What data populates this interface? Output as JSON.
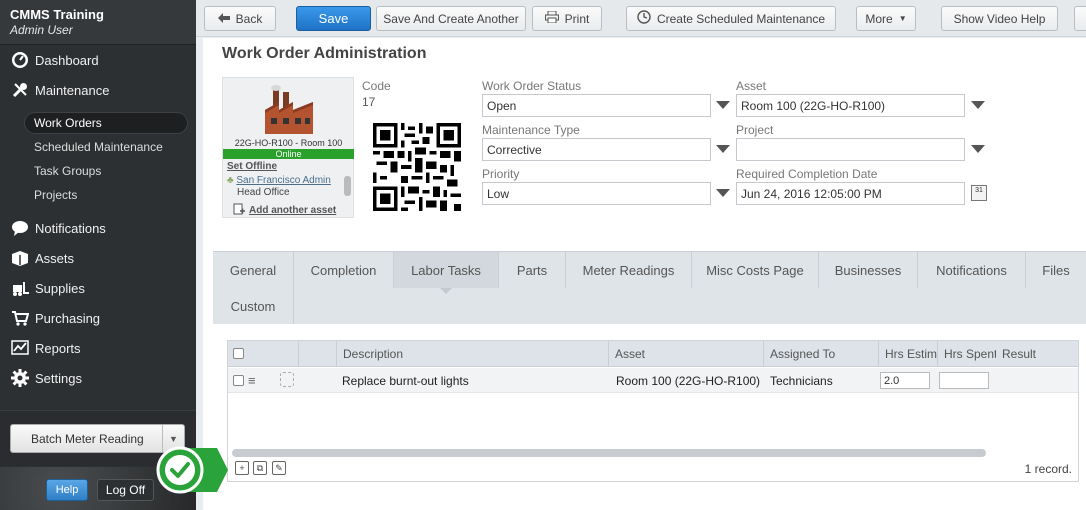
{
  "app": {
    "name": "CMMS Training",
    "user": "Admin User"
  },
  "sidebar": {
    "items": [
      {
        "label": "Dashboard",
        "icon": "dashboard-icon"
      },
      {
        "label": "Maintenance",
        "icon": "tools-icon"
      },
      {
        "label": "Notifications",
        "icon": "chat-bubble-icon"
      },
      {
        "label": "Assets",
        "icon": "boxes-icon"
      },
      {
        "label": "Supplies",
        "icon": "forklift-icon"
      },
      {
        "label": "Purchasing",
        "icon": "cart-icon"
      },
      {
        "label": "Reports",
        "icon": "chart-icon"
      },
      {
        "label": "Settings",
        "icon": "gear-icon"
      }
    ],
    "sub_items": [
      "Work Orders",
      "Scheduled Maintenance",
      "Task Groups",
      "Projects"
    ],
    "active_sub": "Work Orders",
    "batch_label": "Batch Meter Reading",
    "help_label": "Help",
    "logoff_label": "Log Off"
  },
  "toolbar": {
    "back": "Back",
    "save": "Save",
    "save_create": "Save And Create Another",
    "print": "Print",
    "create_sched": "Create Scheduled Maintenance",
    "more": "More",
    "video": "Show Video Help"
  },
  "page": {
    "title": "Work Order Administration"
  },
  "asset_card": {
    "code": "22G-HO-R100 - Room 100",
    "status": "Online",
    "set_offline": "Set Offline",
    "location_1": "San Francisco Admin",
    "location_2": "Head Office",
    "add_asset": "Add another asset"
  },
  "form": {
    "code_label": "Code",
    "code_value": "17",
    "status_label": "Work Order Status",
    "status_value": "Open",
    "mtype_label": "Maintenance Type",
    "mtype_value": "Corrective",
    "priority_label": "Priority",
    "priority_value": "Low",
    "asset_label": "Asset",
    "asset_value": "Room 100 (22G-HO-R100)",
    "project_label": "Project",
    "project_value": "",
    "rcd_label": "Required Completion Date",
    "rcd_value": "Jun 24, 2016 12:05:00 PM",
    "calendar_text": "31"
  },
  "tabs": [
    "General",
    "Completion",
    "Labor Tasks",
    "Parts",
    "Meter Readings",
    "Misc Costs Page",
    "Businesses",
    "Notifications",
    "Files",
    "Custom"
  ],
  "active_tab": "Labor Tasks",
  "grid": {
    "headers": [
      "Description",
      "Asset",
      "Assigned To",
      "Hrs Estim",
      "Hrs Spent",
      "Result"
    ],
    "rows": [
      {
        "description": "Replace burnt-out lights",
        "asset": "Room 100 (22G-HO-R100)",
        "assigned": "Technicians",
        "hrs_est": "2.0",
        "hrs_spent": "",
        "result": ""
      }
    ],
    "record_count": "1 record."
  }
}
